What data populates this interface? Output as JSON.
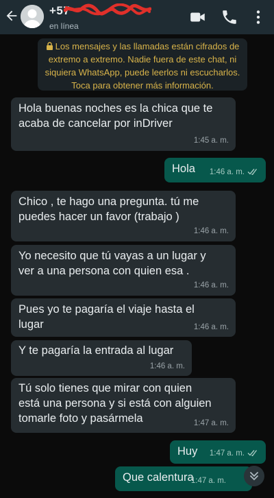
{
  "header": {
    "contact_name": "+57 ",
    "status": "en línea",
    "icons": [
      "back-arrow-icon",
      "avatar-icon",
      "video-call-icon",
      "phone-icon",
      "more-options-icon"
    ]
  },
  "notice": {
    "text": "Los mensajes y las llamadas están cifrados de extremo a extremo. Nadie fuera de este chat, ni siquiera WhatsApp, puede leerlos ni escucharlos. Toca para obtener más información.",
    "color": "#d9b44a"
  },
  "messages": [
    {
      "dir": "in",
      "text": "Hola buenas noches es la chica que te\nacaba de cancelar por inDriver",
      "time": "1:45 a. m."
    },
    {
      "dir": "out",
      "text": "Hola",
      "time": "1:46 a. m."
    },
    {
      "dir": "in",
      "text": "Chico , te hago una pregunta. tú me\npuedes hacer un favor (trabajo )",
      "time": "1:46 a. m."
    },
    {
      "dir": "in",
      "text": "Yo necesito que tú vayas a un lugar y\nver a una persona con quien esa .",
      "time": "1:46 a. m."
    },
    {
      "dir": "in",
      "text": "Pues yo te pagaría el viaje hasta el\nlugar",
      "time": "1:46 a. m."
    },
    {
      "dir": "in",
      "text": "Y te pagaría la entrada al lugar",
      "time": "1:46 a. m."
    },
    {
      "dir": "in",
      "text": "Tú solo tienes que mirar con quien\nestá una persona y si está con alguien\ntomarle foto y pasármela",
      "time": "1:47 a. m."
    },
    {
      "dir": "out",
      "text": "Huy",
      "time": "1:47 a. m."
    },
    {
      "dir": "out",
      "text": "Que calentura",
      "time": "1:47 a. m."
    }
  ],
  "colors": {
    "header_bg": "#1f2c33",
    "incoming_bubble": "#262d31",
    "outgoing_bubble": "#07584c",
    "background": "#0b0b0b",
    "read_ticks": "#53bdeb"
  }
}
